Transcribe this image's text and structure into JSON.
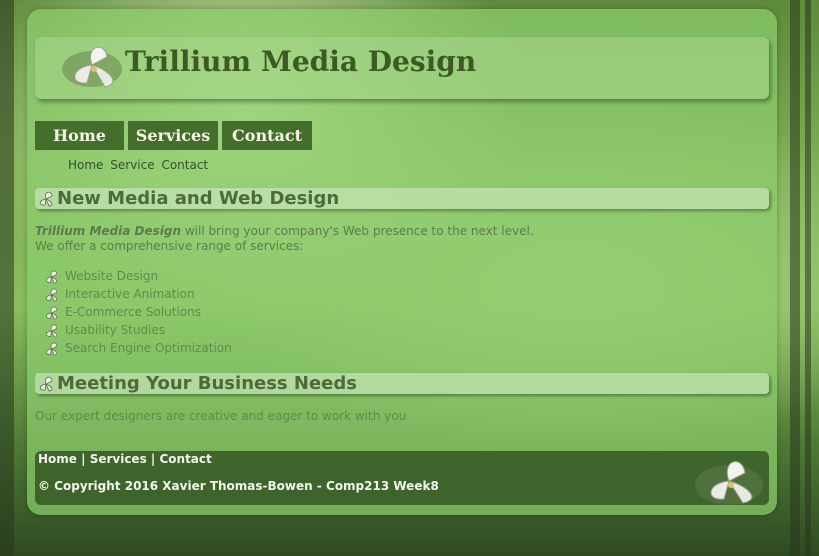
{
  "site": {
    "title": "Trillium Media Design"
  },
  "nav": {
    "buttons": [
      "Home",
      "Services",
      "Contact"
    ],
    "text_links": [
      "Home",
      "Service",
      "Contact"
    ]
  },
  "section1": {
    "heading": "New Media and Web Design",
    "intro_brand": "Trillium Media Design",
    "intro_rest": " will bring your company's Web presence to the next level.",
    "intro_line2": "We offer a comprehensive range of services:",
    "services": [
      "Website Design",
      "Interactive Animation",
      "E-Commerce Solutions",
      "Usability Studies",
      "Search Engine Optimization"
    ]
  },
  "section2": {
    "heading": "Meeting Your Business Needs",
    "text": "Our expert designers are creative and eager to work with you"
  },
  "footer": {
    "links": [
      "Home",
      "Services",
      "Contact"
    ],
    "separator": " | ",
    "copyright": "© Copyright 2016 Xavier Thomas-Bowen - Comp213 Week8"
  },
  "colors": {
    "nav_button": "#456e2c",
    "title": "#3d5a25",
    "footer_bg": "#2e4a1c"
  },
  "icons": {
    "logo": "trillium-flower-icon",
    "bullet": "trillium-bullet-icon"
  }
}
